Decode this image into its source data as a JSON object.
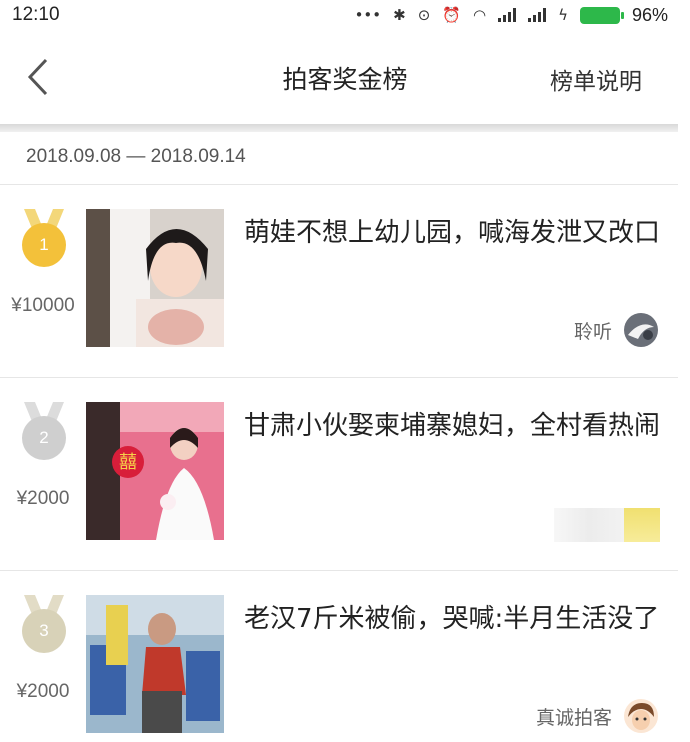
{
  "status_bar": {
    "time": "12:10",
    "battery": "96%",
    "icons": [
      "bluetooth-icon",
      "toggle-icon",
      "alarm-icon",
      "wifi-icon",
      "signal-icon",
      "signal-icon",
      "charging-icon"
    ]
  },
  "nav": {
    "back_icon": "chevron-left-icon",
    "title": "拍客奖金榜",
    "action": "榜单说明"
  },
  "date_range": "2018.09.08 — 2018.09.14",
  "items": [
    {
      "rank": "1",
      "medal": "gold",
      "prize": "¥10000",
      "title": "萌娃不想上幼儿园，喊海发泄又改口",
      "author": "聆听"
    },
    {
      "rank": "2",
      "medal": "silver",
      "prize": "¥2000",
      "title": "甘肃小伙娶柬埔寨媳妇，全村看热闹",
      "author": ""
    },
    {
      "rank": "3",
      "medal": "bronze",
      "prize": "¥2000",
      "title": "老汉7斤米被偷，哭喊:半月生活没了",
      "author": "真诚拍客"
    }
  ],
  "colors": {
    "gold": "#f3c13a",
    "silver": "#cfcfcf",
    "bronze": "#d8d2b8",
    "divider": "#e6e6e6"
  }
}
